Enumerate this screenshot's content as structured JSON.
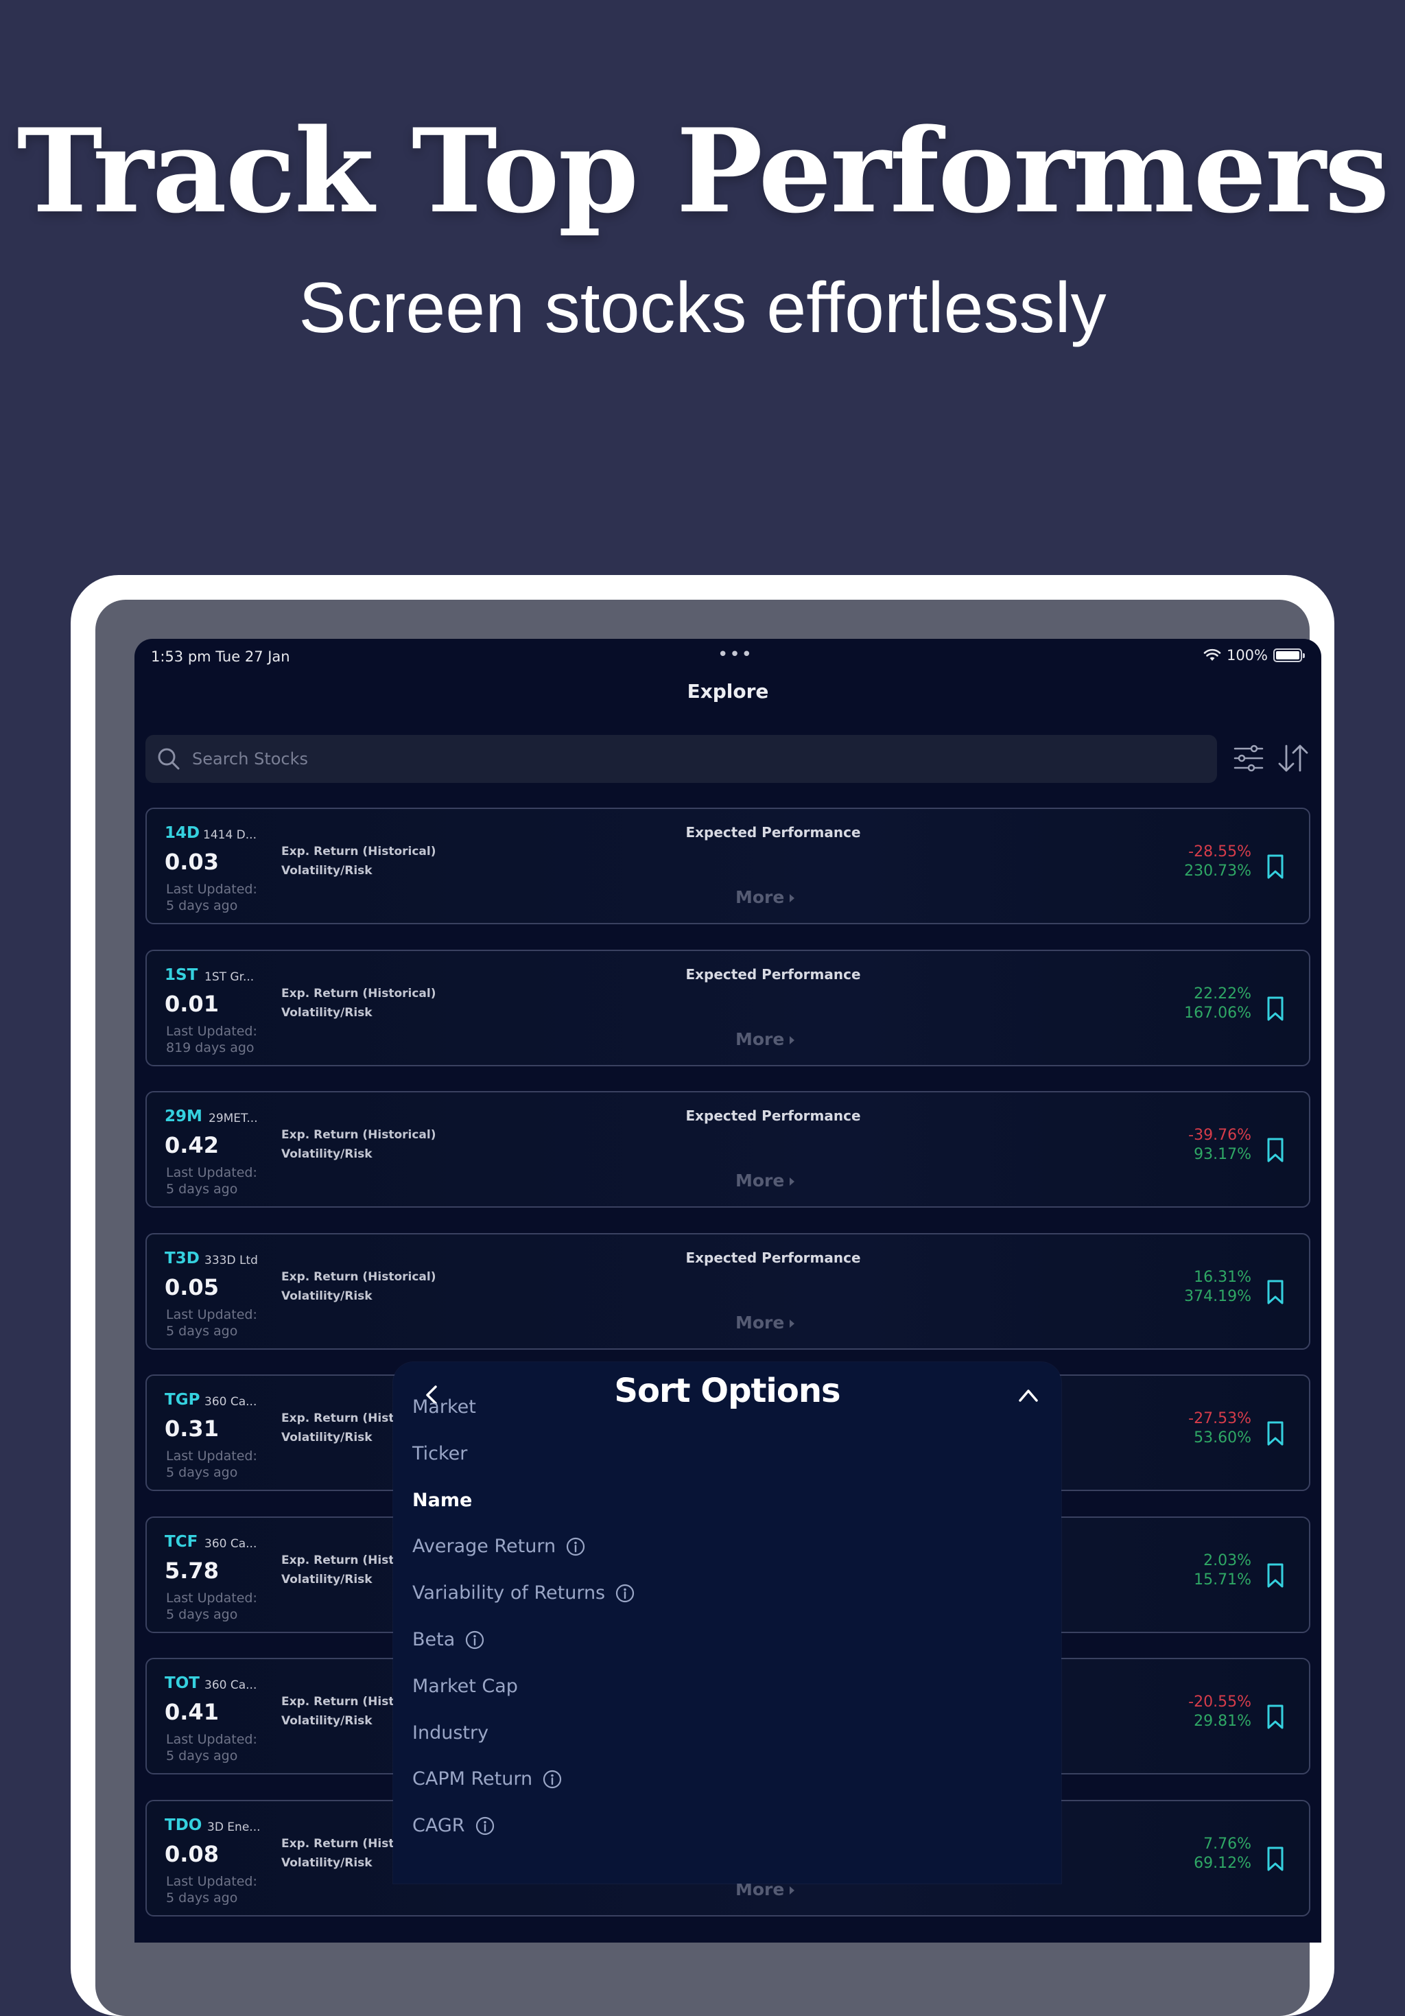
{
  "hero": {
    "title": "Track Top Performers",
    "subtitle": "Screen stocks effortlessly"
  },
  "status_bar": {
    "time": "1:53 pm  Tue 27 Jan",
    "battery": "100%"
  },
  "nav": {
    "title": "Explore"
  },
  "search": {
    "placeholder": "Search Stocks"
  },
  "card_labels": {
    "expected_performance": "Expected Performance",
    "metric1": "Exp. Return (Historical)",
    "metric2": "Volatility/Risk",
    "last_updated": "Last Updated:",
    "more": "More"
  },
  "stocks": [
    {
      "ticker": "14D",
      "company": "1414 D...",
      "price": "0.03",
      "updated": "5 days ago",
      "exp_return": "-28.55%",
      "volatility": "230.73%",
      "return_positive": false
    },
    {
      "ticker": "1ST",
      "company": "1ST Gr...",
      "price": "0.01",
      "updated": "819 days ago",
      "exp_return": "22.22%",
      "volatility": "167.06%",
      "return_positive": true
    },
    {
      "ticker": "29M",
      "company": "29MET...",
      "price": "0.42",
      "updated": "5 days ago",
      "exp_return": "-39.76%",
      "volatility": "93.17%",
      "return_positive": false
    },
    {
      "ticker": "T3D",
      "company": "333D Ltd",
      "price": "0.05",
      "updated": "5 days ago",
      "exp_return": "16.31%",
      "volatility": "374.19%",
      "return_positive": true
    },
    {
      "ticker": "TGP",
      "company": "360 Ca...",
      "price": "0.31",
      "updated": "5 days ago",
      "exp_return": "-27.53%",
      "volatility": "53.60%",
      "return_positive": false
    },
    {
      "ticker": "TCF",
      "company": "360 Ca...",
      "price": "5.78",
      "updated": "5 days ago",
      "exp_return": "2.03%",
      "volatility": "15.71%",
      "return_positive": true
    },
    {
      "ticker": "TOT",
      "company": "360 Ca...",
      "price": "0.41",
      "updated": "5 days ago",
      "exp_return": "-20.55%",
      "volatility": "29.81%",
      "return_positive": false
    },
    {
      "ticker": "TDO",
      "company": "3D Ene...",
      "price": "0.08",
      "updated": "5 days ago",
      "exp_return": "7.76%",
      "volatility": "69.12%",
      "return_positive": true
    }
  ],
  "sort_modal": {
    "title": "Sort Options",
    "selected": "Name",
    "options": [
      {
        "label": "Market",
        "info": false
      },
      {
        "label": "Ticker",
        "info": false
      },
      {
        "label": "Name",
        "info": false
      },
      {
        "label": "Average Return",
        "info": true
      },
      {
        "label": "Variability of Returns",
        "info": true
      },
      {
        "label": "Beta",
        "info": true
      },
      {
        "label": "Market Cap",
        "info": false
      },
      {
        "label": "Industry",
        "info": false
      },
      {
        "label": "CAPM Return",
        "info": true
      },
      {
        "label": "CAGR",
        "info": true
      }
    ]
  },
  "colors": {
    "page_background": "#2e3150",
    "screen_background": "#070d28",
    "ticker_accent": "#35d1df",
    "negative": "#d63c4a",
    "positive": "#2fa865",
    "modal_background": "#081436"
  }
}
